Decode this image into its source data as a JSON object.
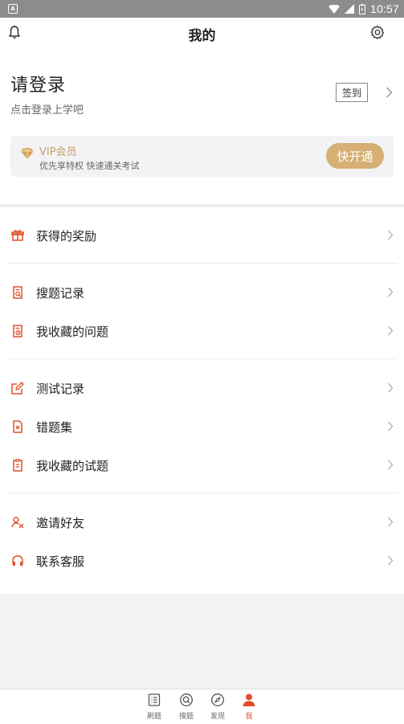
{
  "status_bar": {
    "time": "10:57",
    "left_glyph": "A"
  },
  "header": {
    "title": "我的"
  },
  "profile": {
    "login_title": "请登录",
    "login_subtitle": "点击登录上学吧",
    "checkin_label": "签到"
  },
  "vip": {
    "title": "VIP会员",
    "description": "优先享特权 快速通关考试",
    "button_label": "快开通"
  },
  "menu": {
    "items": [
      {
        "label": "获得的奖励",
        "icon": "gift-icon"
      },
      {
        "label": "搜题记录",
        "icon": "search-record-icon"
      },
      {
        "label": "我收藏的问题",
        "icon": "favorite-question-icon"
      },
      {
        "label": "测试记录",
        "icon": "edit-icon"
      },
      {
        "label": "错题集",
        "icon": "wrong-question-icon"
      },
      {
        "label": "我收藏的试题",
        "icon": "favorite-exam-icon"
      },
      {
        "label": "邀请好友",
        "icon": "invite-friend-icon"
      },
      {
        "label": "联系客服",
        "icon": "headphones-icon"
      }
    ]
  },
  "tabbar": {
    "tabs": [
      {
        "label": "刷题",
        "icon": "list-icon"
      },
      {
        "label": "搜题",
        "icon": "search-icon"
      },
      {
        "label": "发现",
        "icon": "compass-icon"
      },
      {
        "label": "我",
        "icon": "user-icon",
        "active": true
      }
    ]
  },
  "colors": {
    "accent": "#e0502c",
    "vip_gold": "#d5af74",
    "vip_text": "#c8a062"
  }
}
